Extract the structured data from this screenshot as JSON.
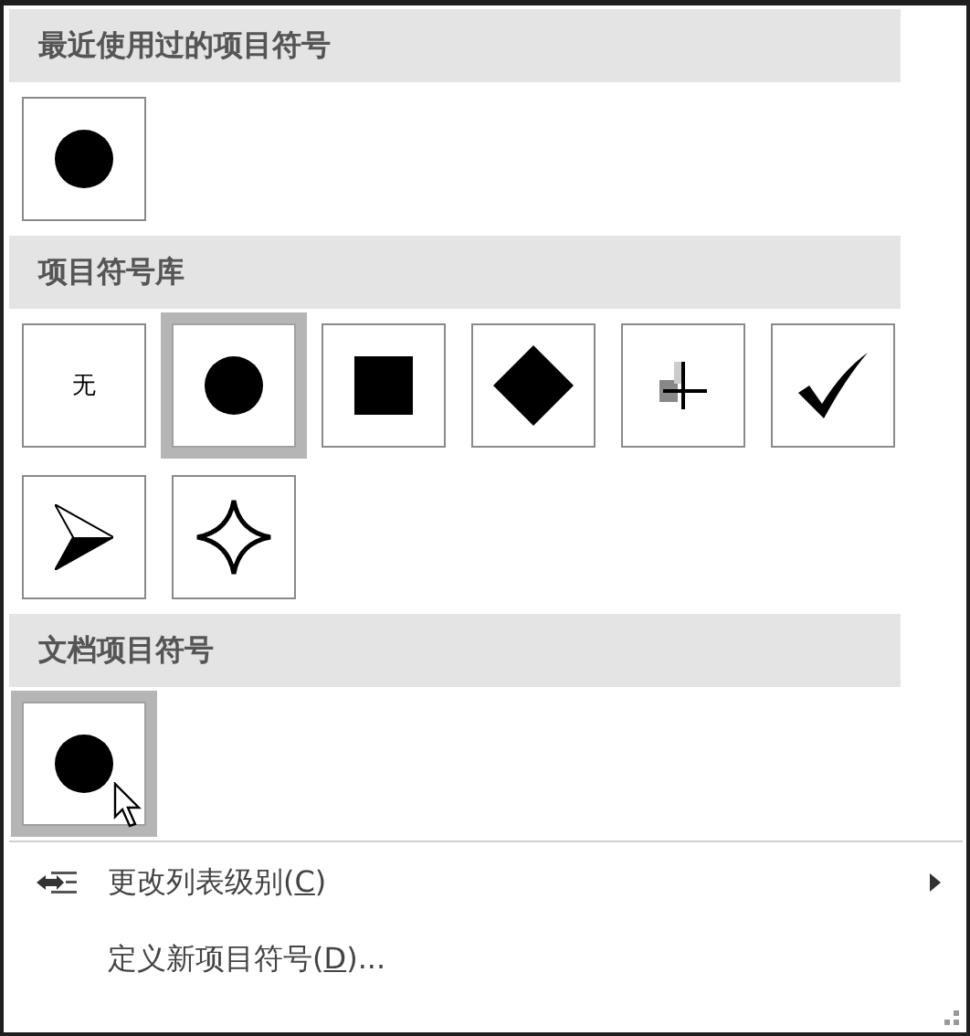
{
  "sections": [
    {
      "title": "最近使用过的项目符号",
      "tiles": [
        {
          "kind": "dot",
          "selected": false
        }
      ]
    },
    {
      "title": "项目符号库",
      "tiles": [
        {
          "kind": "none",
          "text": "无",
          "selected": false
        },
        {
          "kind": "dot",
          "selected": true
        },
        {
          "kind": "square",
          "selected": false
        },
        {
          "kind": "diamond",
          "selected": false
        },
        {
          "kind": "cross",
          "selected": false
        },
        {
          "kind": "check",
          "selected": false
        },
        {
          "kind": "arrowhead",
          "selected": false
        },
        {
          "kind": "star",
          "selected": false
        }
      ]
    },
    {
      "title": "文档项目符号",
      "tiles": [
        {
          "kind": "dot",
          "selected": true
        }
      ]
    }
  ],
  "menu_items": [
    {
      "label_before": "更改列表级别(",
      "access_key": "C",
      "label_after": ")",
      "icon": true,
      "submenu": true
    },
    {
      "label_before": "定义新项目符号(",
      "access_key": "D",
      "label_after": ")...",
      "icon": false,
      "submenu": false
    }
  ]
}
